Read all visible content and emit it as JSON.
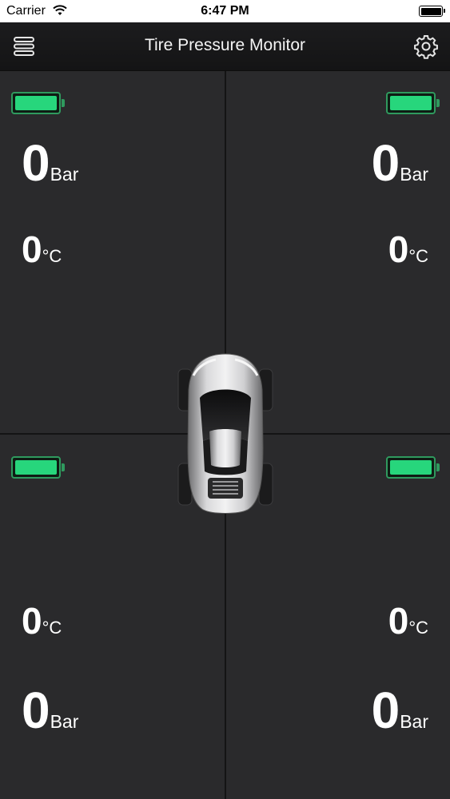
{
  "status_bar": {
    "carrier": "Carrier",
    "time": "6:47 PM"
  },
  "nav": {
    "title": "Tire Pressure Monitor",
    "menu_icon": "menu-icon",
    "settings_icon": "gear-icon"
  },
  "colors": {
    "battery_green": "#27d67c",
    "background": "#2a2a2c",
    "nav_bar": "#1a1a1b"
  },
  "tires": {
    "front_left": {
      "pressure": "0",
      "pressure_unit": "Bar",
      "temperature": "0",
      "temperature_unit": "°C",
      "battery_level": 1.0
    },
    "front_right": {
      "pressure": "0",
      "pressure_unit": "Bar",
      "temperature": "0",
      "temperature_unit": "°C",
      "battery_level": 1.0
    },
    "rear_left": {
      "pressure": "0",
      "pressure_unit": "Bar",
      "temperature": "0",
      "temperature_unit": "°C",
      "battery_level": 1.0
    },
    "rear_right": {
      "pressure": "0",
      "pressure_unit": "Bar",
      "temperature": "0",
      "temperature_unit": "°C",
      "battery_level": 1.0
    }
  }
}
